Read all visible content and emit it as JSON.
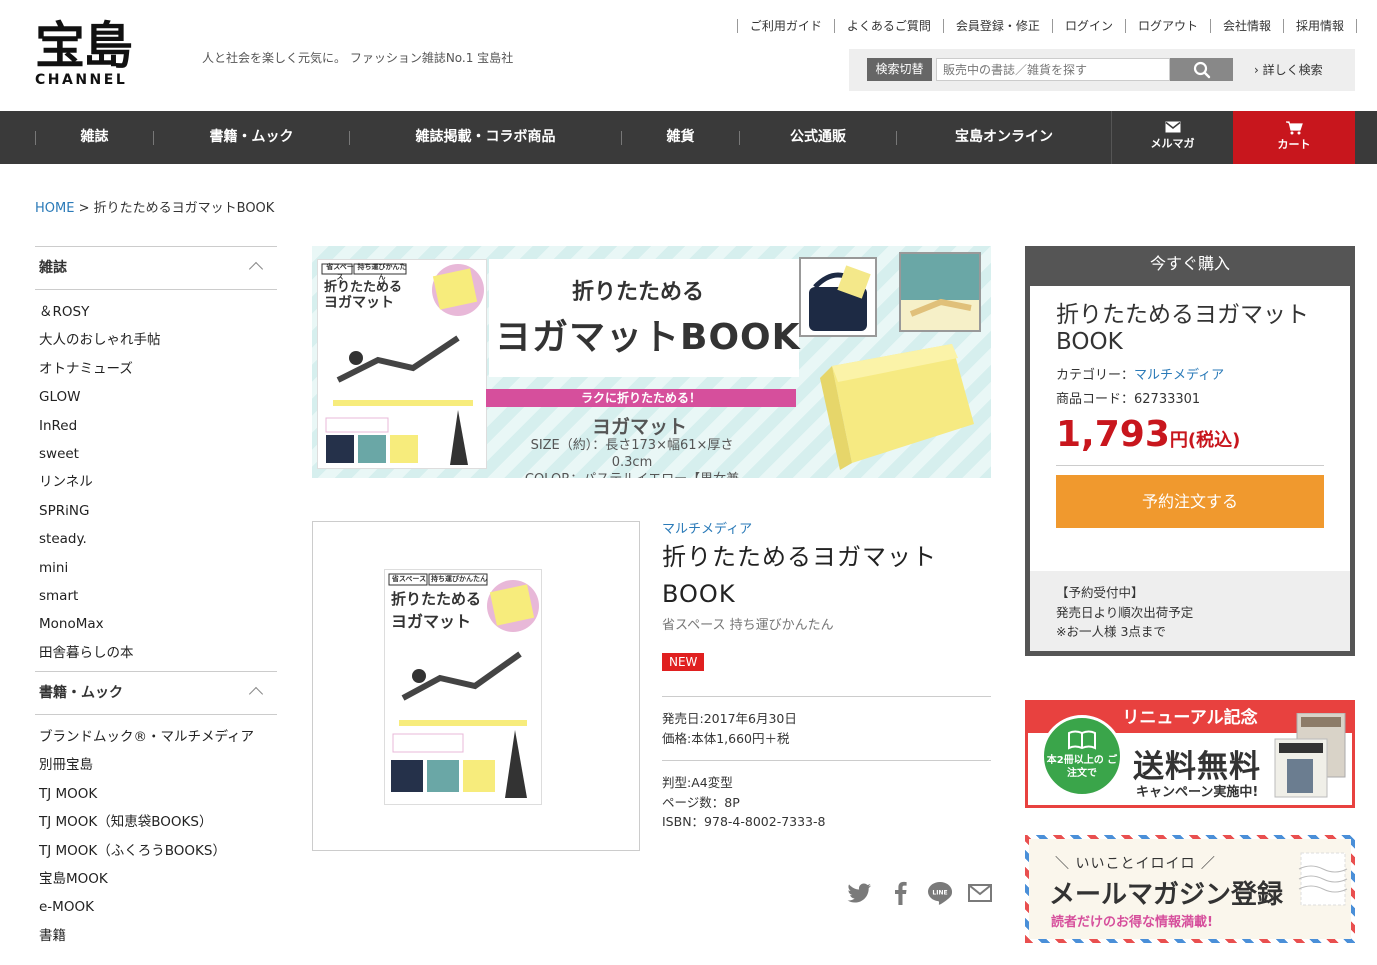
{
  "header": {
    "logo_kanji": "宝島",
    "logo_channel": "CHANNEL",
    "tagline": "人と社会を楽しく元気に。 ファッション雑誌No.1 宝島社",
    "top_links": [
      "ご利用ガイド",
      "よくあるご質問",
      "会員登録・修正",
      "ログイン",
      "ログアウト",
      "会社情報",
      "採用情報"
    ],
    "search_toggle": "検索切替",
    "search_placeholder": "販売中の書誌／雑貨を探す",
    "advanced_search": "› 詳しく検索"
  },
  "nav": {
    "items": [
      "雑誌",
      "書籍・ムック",
      "雑誌掲載・コラボ商品",
      "雑貨",
      "公式通販",
      "宝島オンライン"
    ],
    "mail_label": "メルマガ",
    "cart_label": "カート"
  },
  "breadcrumb": {
    "home": "HOME",
    "separator": " > ",
    "current": "折りたためるヨガマットBOOK"
  },
  "sidebar": {
    "sections": [
      {
        "title": "雑誌",
        "items": [
          "＆ROSY",
          "大人のおしゃれ手帖",
          "オトナミューズ",
          "GLOW",
          "InRed",
          "sweet",
          "リンネル",
          "SPRiNG",
          "steady.",
          "mini",
          "smart",
          "MonoMax",
          "田舎暮らしの本"
        ]
      },
      {
        "title": "書籍・ムック",
        "items": [
          "ブランドムック®・マルチメディア",
          "別冊宝島",
          "TJ MOOK",
          "TJ MOOK（知恵袋BOOKS）",
          "TJ MOOK（ふくろうBOOKS）",
          "宝島MOOK",
          "e-MOOK",
          "書籍"
        ]
      }
    ]
  },
  "banner": {
    "title_small": "折りたためる",
    "title_big": "ヨガマットBOOK",
    "pink_label": "ラクに折りたためる！",
    "item_name": "ヨガマット",
    "size": "SIZE（約）：長さ173×幅61×厚さ0.3cm",
    "color": "COLOR：パステルイエロー【男女兼用】",
    "cover_tag1": "省スペース",
    "cover_tag2": "持ち運びかんたん",
    "cover_title1": "折りたためる",
    "cover_title2": "ヨガマット"
  },
  "product": {
    "category": "マルチメディア",
    "title": "折りたためるヨガマットBOOK",
    "subtitle": "省スペース 持ち運びかんたん",
    "badge": "NEW",
    "release": "発売日:2017年6月30日",
    "price": "価格:本体1,660円＋税",
    "format": "判型:A4変型",
    "pages": "ページ数：8P",
    "isbn": "ISBN：978-4-8002-7333-8"
  },
  "buybox": {
    "header": "今すぐ購入",
    "title": "折りたためるヨガマットBOOK",
    "category_label": "カテゴリー：",
    "category_value": "マルチメディア",
    "code": "商品コード：62733301",
    "price_number": "1,793",
    "price_suffix": "円(税込)",
    "button": "予約注文する",
    "note1": "【予約受付中】",
    "note2": "発売日より順次出荷予定",
    "note3": "※お一人様 3点まで"
  },
  "promo_shipping": {
    "header": "リニューアル記念",
    "circle": "本2冊以上の ご注文で",
    "big": "送料無料",
    "small": "キャンペーン実施中!"
  },
  "promo_mail": {
    "top": "＼ いいことイロイロ ／",
    "big": "メールマガジン登録",
    "small": "読者だけのお得な情報満載!"
  },
  "colors": {
    "nav_bg": "#3a3a3a",
    "cart_red": "#c8161d",
    "price_red": "#c8161d",
    "link_blue": "#2a7ab8",
    "order_orange": "#f0992e",
    "new_badge": "#e02020"
  }
}
